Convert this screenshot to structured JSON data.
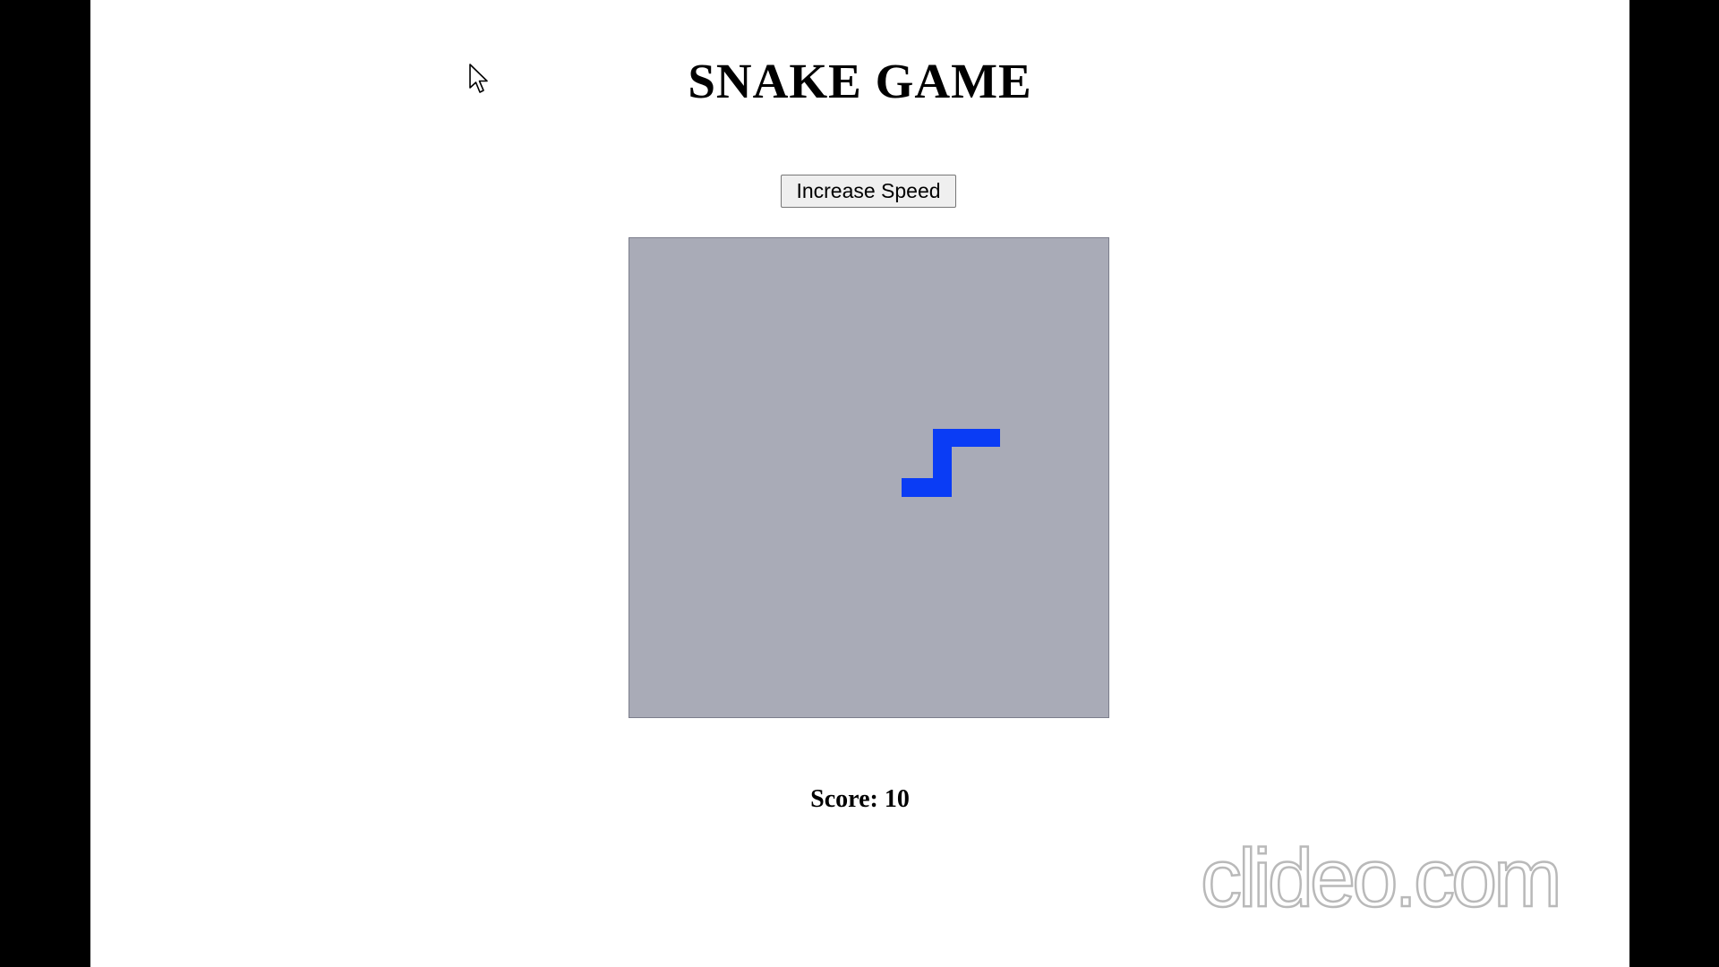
{
  "page": {
    "title": "SNAKE GAME"
  },
  "controls": {
    "speed_button_label": "Increase Speed"
  },
  "score": {
    "text": "Score: 10",
    "value": 10
  },
  "board": {
    "background": "#a9abb7",
    "snake_color": "#0a3cf5"
  },
  "watermark": {
    "text": "clideo.com"
  }
}
